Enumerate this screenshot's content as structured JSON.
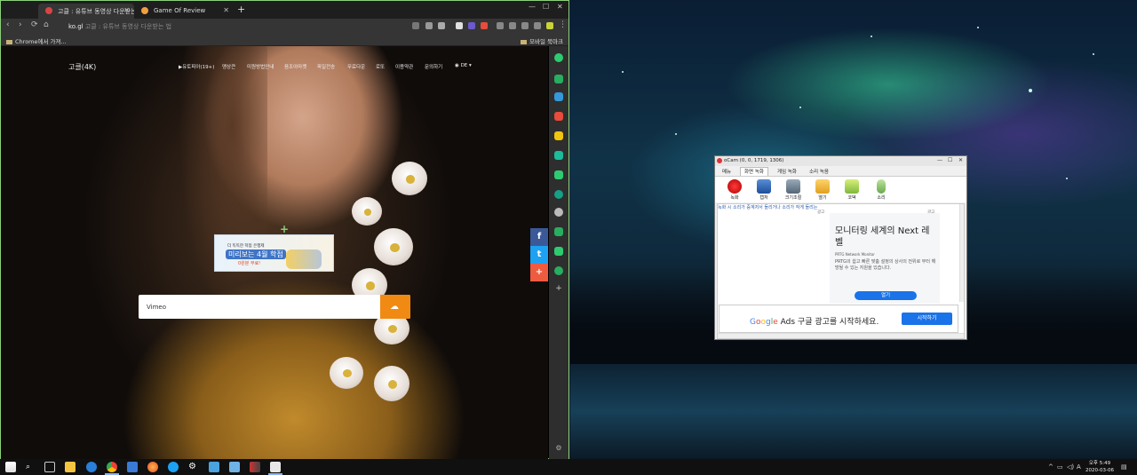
{
  "browser": {
    "tabs": [
      {
        "title": "고클 : 유튜브 동영상 다운받는 법",
        "active": true
      },
      {
        "title": "Game Of Review",
        "active": false
      }
    ],
    "url_host": "ko.gl",
    "url_title": "고클 : 유튜브 동영상 다운받는 법",
    "bookmarks": {
      "left": "Chrome에서 가져...",
      "right": "모바일 북마크"
    }
  },
  "page": {
    "logo": "고클(4K)",
    "nav": [
      "▶유토피아(19+)",
      "맹상큰",
      "미원방법안내",
      "음조아마켓",
      "파일전송",
      "무료다운",
      "로또",
      "이용약관",
      "문의하기",
      "DE"
    ],
    "ad": {
      "line1": "더 똑똑한 학점 은행제",
      "line2": "미리보는 4월 학점",
      "line3": "0원분 무료!"
    },
    "search": {
      "value": "Vimeo"
    },
    "share": {
      "facebook": "f",
      "twitter": "t",
      "add": "+"
    }
  },
  "ocam": {
    "title": "oCam (0, 0, 1719, 1306)",
    "menu": [
      "메뉴",
      "화면 녹화",
      "게임 녹화",
      "소리 녹음"
    ],
    "tools": [
      "녹화",
      "캡처",
      "크기조절",
      "열기",
      "코덱",
      "소리"
    ],
    "marquee": "녹화 시 소리가 증계저서 들리거나 소리가 작게 들리는",
    "ad_tag": "광고",
    "ad": {
      "title": "모니터링 세계의 Next 레벨",
      "sponsor": "PRTG Network Monitor",
      "desc": "PRTG의 쉽고 빠른 맞춤 설정의 상사의 전위로 부터 해방될 수 있는 지원을 있습니다.",
      "button": "열기"
    },
    "google_ads": {
      "text": "구글 광고를 시작하세요.",
      "button": "시작하기"
    }
  },
  "taskbar": {
    "time": "오후 5:49",
    "date": "2020-03-06",
    "ime": "A"
  }
}
